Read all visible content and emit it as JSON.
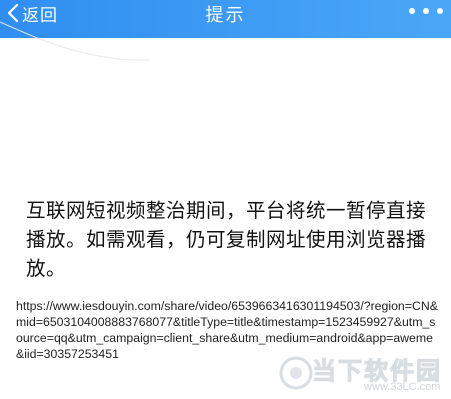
{
  "header": {
    "back_label": "返回",
    "title": "提示",
    "more_icon": "more-dots-icon"
  },
  "notice": {
    "message": "互联网短视频整治期间，平台将统一暂停直接播放。如需观看，仍可复制网址使用浏览器播放。"
  },
  "link": {
    "url": "https://www.iesdouyin.com/share/video/6539663416301194503/?region=CN&mid=6503104008883768077&titleType=title&timestamp=1523459927&utm_source=qq&utm_campaign=client_share&utm_medium=android&app=aweme&iid=30357253451"
  },
  "watermark": {
    "text": "当下软件园",
    "site": "www.33LC.com"
  },
  "colors": {
    "header_start": "#2f8ef0",
    "header_end": "#4aa7f7",
    "text": "#111111",
    "background": "#ffffff"
  }
}
